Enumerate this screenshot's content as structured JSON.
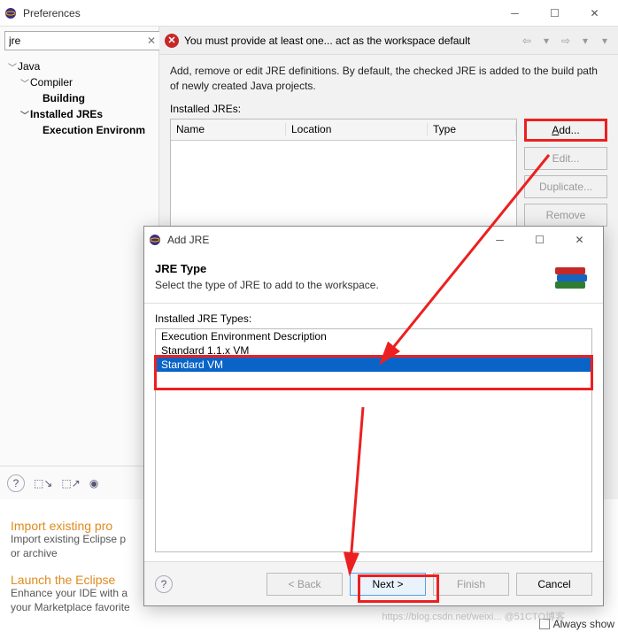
{
  "pref": {
    "title": "Preferences",
    "search": "jre",
    "error": "You must provide at least one... act as the workspace default",
    "desc": "Add, remove or edit JRE definitions. By default, the checked JRE is added to the build path of newly created Java projects.",
    "installed_label": "Installed JREs:",
    "cols": {
      "name": "Name",
      "location": "Location",
      "type": "Type"
    },
    "buttons": {
      "add": "Add...",
      "edit": "Edit...",
      "dup": "Duplicate...",
      "remove": "Remove"
    }
  },
  "tree": {
    "java": "Java",
    "compiler": "Compiler",
    "building": "Building",
    "installed": "Installed JREs",
    "exec": "Execution Environm"
  },
  "dlg": {
    "title": "Add JRE",
    "heading": "JRE Type",
    "sub": "Select the type of JRE to add to the workspace.",
    "types_label": "Installed JRE Types:",
    "types": [
      "Execution Environment Description",
      "Standard 1.1.x VM",
      "Standard VM"
    ],
    "buttons": {
      "back": "< Back",
      "next": "Next >",
      "finish": "Finish",
      "cancel": "Cancel"
    }
  },
  "hints": {
    "import_title": "Import existing pro",
    "import_body": "Import existing Eclipse p\nor archive",
    "launch_title": "Launch the Eclipse",
    "launch_body": "Enhance your IDE with a\nyour Marketplace favorite"
  },
  "footer": {
    "always": "Always show"
  },
  "watermark": "https://blog.csdn.net/weixi... @51CTO博客"
}
